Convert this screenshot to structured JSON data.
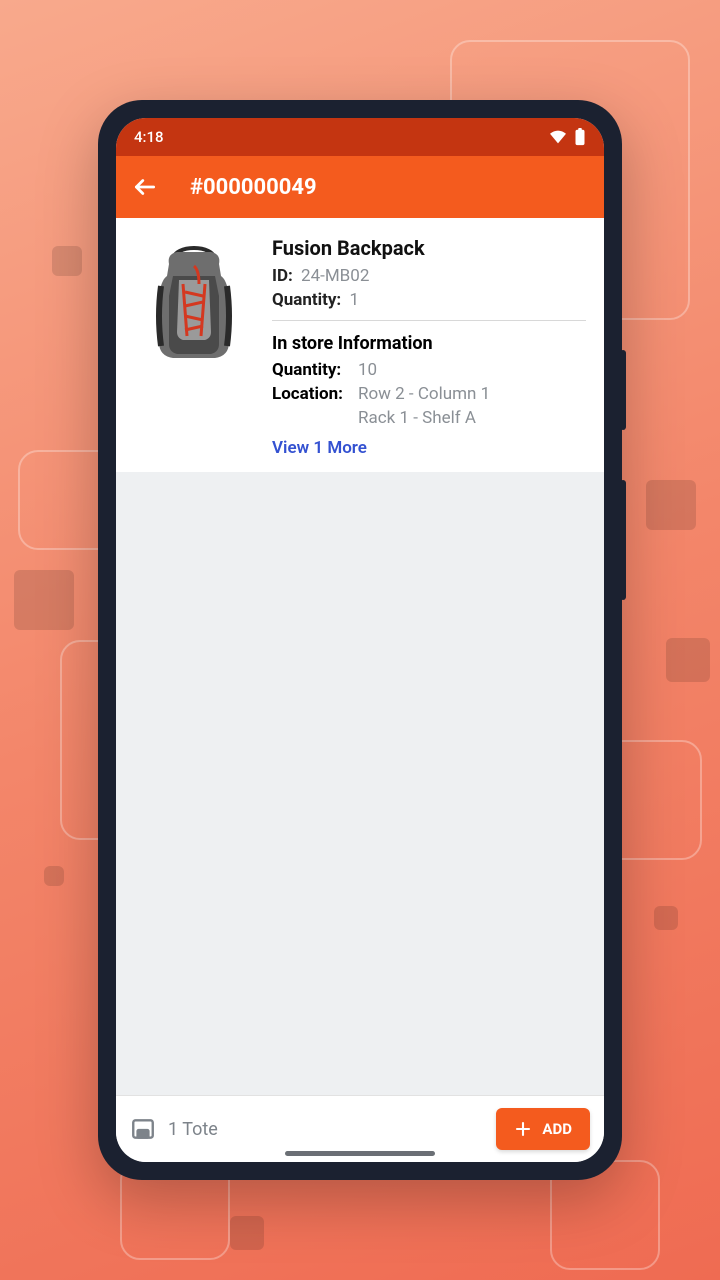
{
  "status_bar": {
    "time": "4:18"
  },
  "header": {
    "title": "#000000049"
  },
  "product": {
    "name": "Fusion Backpack",
    "id_label": "ID:",
    "id_value": "24-MB02",
    "qty_label": "Quantity:",
    "qty_value": "1"
  },
  "store": {
    "section_title": "In store Information",
    "qty_label": "Quantity:",
    "qty_value": "10",
    "loc_label": "Location:",
    "loc_line1": "Row 2 - Column 1",
    "loc_line2": "Rack 1 - Shelf A"
  },
  "view_more": "View 1 More",
  "bottom": {
    "tote_text": "1 Tote",
    "add_label": "ADD"
  }
}
